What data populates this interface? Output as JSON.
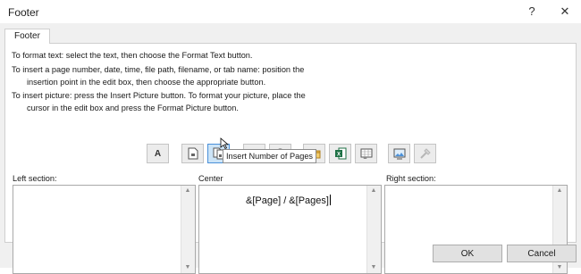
{
  "window": {
    "title": "Footer",
    "help_icon": "?",
    "close_icon": "✕"
  },
  "tab": {
    "label": "Footer"
  },
  "instructions": [
    "To format text:  select the text, then choose the Format Text button.",
    "To insert a page number, date, time, file path, filename, or tab name:  position the",
    "insertion point in the edit box, then choose the appropriate button.",
    "To insert picture: press the Insert Picture button.  To format your picture, place the",
    "cursor in the edit box and press the Format Picture button."
  ],
  "toolbar": [
    {
      "name": "format-text",
      "icon": "letter-a-icon",
      "glyph": "A"
    },
    {
      "name": "insert-page-number",
      "icon": "page-number-icon"
    },
    {
      "name": "insert-number-of-pages",
      "icon": "number-of-pages-icon"
    },
    {
      "name": "insert-date",
      "icon": "calendar-icon"
    },
    {
      "name": "insert-time",
      "icon": "clock-icon"
    },
    {
      "name": "insert-file-path",
      "icon": "folder-icon"
    },
    {
      "name": "insert-file-name",
      "icon": "excel-file-icon"
    },
    {
      "name": "insert-sheet-name",
      "icon": "sheet-tab-icon"
    },
    {
      "name": "insert-picture",
      "icon": "picture-icon"
    },
    {
      "name": "format-picture",
      "icon": "format-picture-icon"
    }
  ],
  "tooltip": "Insert Number of Pages",
  "sections": {
    "left": {
      "label": "Left section:",
      "content": ""
    },
    "center": {
      "label": "Center",
      "content": "&[Page] / &[Pages]"
    },
    "right": {
      "label": "Right section:",
      "content": ""
    }
  },
  "buttons": {
    "ok": "OK",
    "cancel": "Cancel"
  },
  "colors": {
    "accent": "#4a90d9",
    "excel_green": "#1e7145"
  }
}
